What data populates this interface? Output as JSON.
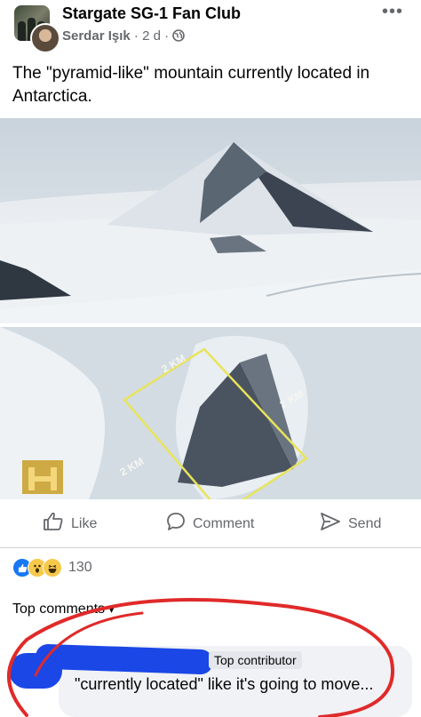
{
  "post": {
    "group_name": "Stargate SG-1 Fan Club",
    "author": "Serdar Işık",
    "separator": " · ",
    "time": "2 d",
    "audience_sep": " · ",
    "body": "The \"pyramid-like\" mountain currently located in Antarctica.",
    "more_icon": "more-dots-icon",
    "audience_icon": "globe-icon"
  },
  "images": {
    "image1_alt": "pyramid mountain photo",
    "image2_labels": {
      "top": "2 KM",
      "right": "2 KM",
      "left": "2 KM"
    },
    "watermark": "H"
  },
  "actions": {
    "like_label": "Like",
    "comment_label": "Comment",
    "send_label": "Send"
  },
  "reactions": {
    "icons": [
      "like-reaction-icon",
      "wow-reaction-icon",
      "haha-reaction-icon"
    ],
    "count": "130"
  },
  "comments": {
    "heading": "Top comments",
    "first": {
      "badge": "Top contributor",
      "text": "\"currently located\" like it's going to move..."
    }
  }
}
